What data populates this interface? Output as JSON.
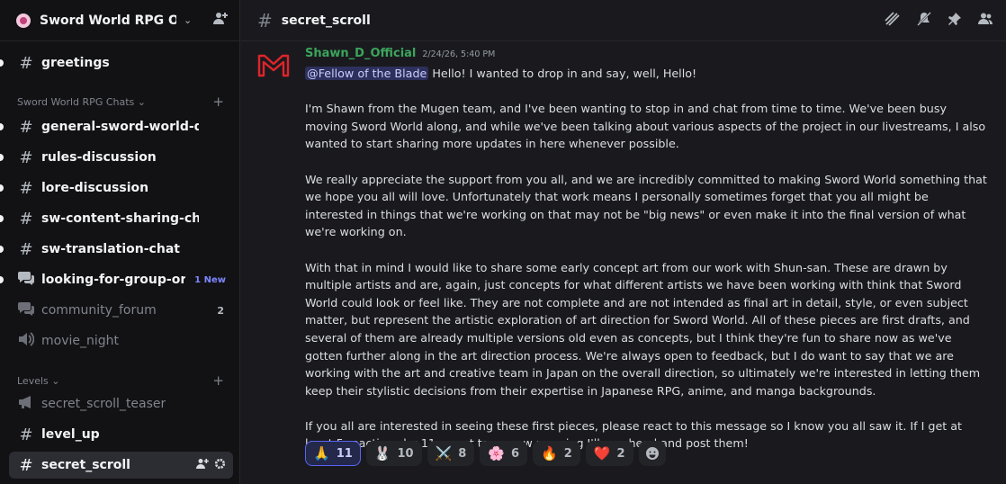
{
  "server": {
    "name": "Sword World RPG Offi...",
    "chevron": "⌄",
    "invite_icon": "add-member-icon"
  },
  "channels_top": [
    {
      "label": "greetings",
      "icon": "#"
    }
  ],
  "categories": [
    {
      "label": "Sword World RPG Chats ⌄",
      "plus": "+"
    },
    {
      "label": "Levels ⌄",
      "plus": "+"
    }
  ],
  "channels_chats": [
    {
      "label": "general-sword-world-discuss...",
      "icon": "#"
    },
    {
      "label": "rules-discussion",
      "icon": "#"
    },
    {
      "label": "lore-discussion",
      "icon": "#"
    },
    {
      "label": "sw-content-sharing-channel",
      "icon": "#"
    },
    {
      "label": "sw-translation-chat",
      "icon": "#"
    },
    {
      "label": "looking-for-group-or-p...",
      "icon": "💬",
      "badge": "1 New"
    },
    {
      "label": "community_forum",
      "icon": "💬",
      "count": "2"
    },
    {
      "label": "movie_night",
      "icon": "🔊"
    }
  ],
  "channels_levels": [
    {
      "label": "secret_scroll_teaser",
      "icon": "📢"
    },
    {
      "label": "level_up",
      "icon": "#"
    },
    {
      "label": "secret_scroll",
      "icon": "#"
    }
  ],
  "topbar": {
    "hash": "#",
    "title": "secret_scroll"
  },
  "message": {
    "author": "Shawn_D_Official",
    "timestamp": "2/24/26, 5:40 PM",
    "mention": "@Fellow of the Blade",
    "first_line": " Hello! I wanted to drop in and say, well, Hello!",
    "paragraphs": [
      "I'm Shawn from the Mugen team, and I've been wanting to stop in and chat from time to time. We've been busy moving Sword World along, and while we've been talking about various aspects of the project in our livestreams, I also wanted to start sharing more updates in here whenever possible.",
      "We really appreciate the support from you all, and we are incredibly committed to making Sword World something that we hope you all will love. Unfortunately that work means I personally sometimes forget that you all might be interested in things that we're working on that may not be \"big news\" or even make it into the final version of what we're working on.",
      "With that in mind I would like to share some early concept art from our work with Shun-san. These are drawn by multiple artists and are, again, just concepts for what different artists we have been working with think that Sword World could look or feel like. They are not complete and are not intended as final art in detail, style, or even subject matter, but represent the artistic exploration of art direction for Sword World. All of these pieces are first drafts, and several of them are already multiple versions old even as concepts, but I think they're fun to share now as we've gotten further along in the art direction process. We're always open to feedback, but I do want to say that we are working with the art and creative team in Japan on the overall direction, so ultimately we're interested in letting them keep their stylistic decisions from their expertise in Japanese RPG, anime, and manga backgrounds.",
      "If you all are interested in seeing these first pieces, please react to this message so I know you all saw it. If I get at least 5 reactions by 11am cst tomorrow morning I'll go ahead and post them!"
    ]
  },
  "reactions": [
    {
      "emoji": "🙏",
      "count": "11",
      "mine": true
    },
    {
      "emoji": "🐰",
      "count": "10"
    },
    {
      "emoji": "⚔️",
      "count": "8"
    },
    {
      "emoji": "🌸",
      "count": "6"
    },
    {
      "emoji": "🔥",
      "count": "2"
    },
    {
      "emoji": "❤️",
      "count": "2"
    }
  ],
  "colors": {
    "accent": "#5865f2",
    "author": "#3ba55c",
    "new_badge": "#7c86ff",
    "logo": "#e0242b"
  }
}
